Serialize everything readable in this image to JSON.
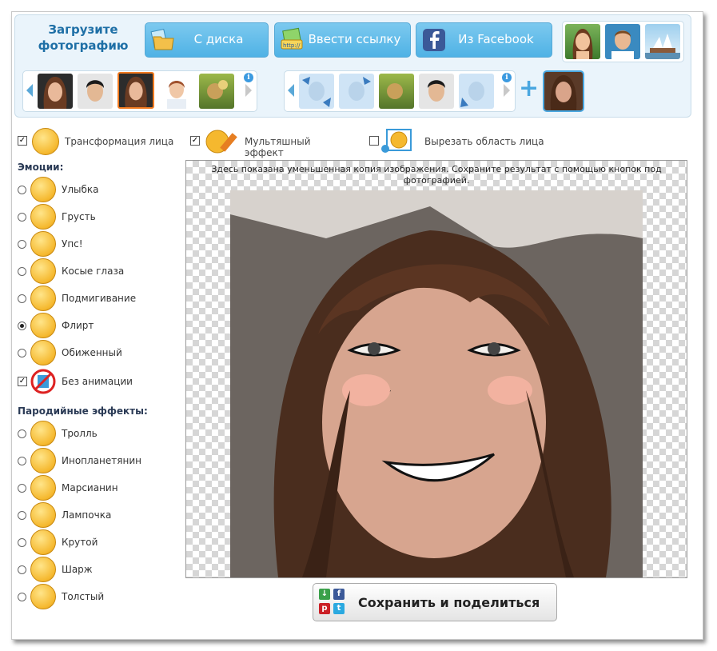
{
  "upload": {
    "title": "Загрузите фотографию",
    "buttons": {
      "disk": "С диска",
      "link": "Ввести ссылку",
      "facebook": "Из Facebook"
    }
  },
  "effects": {
    "face_transform": {
      "label": "Трансформация лица",
      "checked": true
    },
    "cartoon": {
      "label": "Мультяшный эффект",
      "checked": true
    },
    "crop_face": {
      "label": "Вырезать область лица",
      "checked": false
    }
  },
  "emotions": {
    "heading": "Эмоции:",
    "items": [
      "Улыбка",
      "Грусть",
      "Упс!",
      "Косые глаза",
      "Подмигивание",
      "Флирт",
      "Обиженный"
    ],
    "selected": "Флирт",
    "no_animation": {
      "label": "Без анимации",
      "checked": true
    }
  },
  "parody": {
    "heading": "Пародийные эффекты:",
    "items": [
      "Тролль",
      "Инопланетянин",
      "Марсианин",
      "Лампочка",
      "Крутой",
      "Шарж",
      "Толстый"
    ]
  },
  "canvas": {
    "notice": "Здесь показана уменьшенная копия изображения. Сохраните результат с помощью кнопок под фотографией."
  },
  "save": {
    "label": "Сохранить и поделиться"
  },
  "colors": {
    "accent": "#4fb2e5",
    "heading": "#1e6fa6",
    "facebook": "#3b5998"
  }
}
